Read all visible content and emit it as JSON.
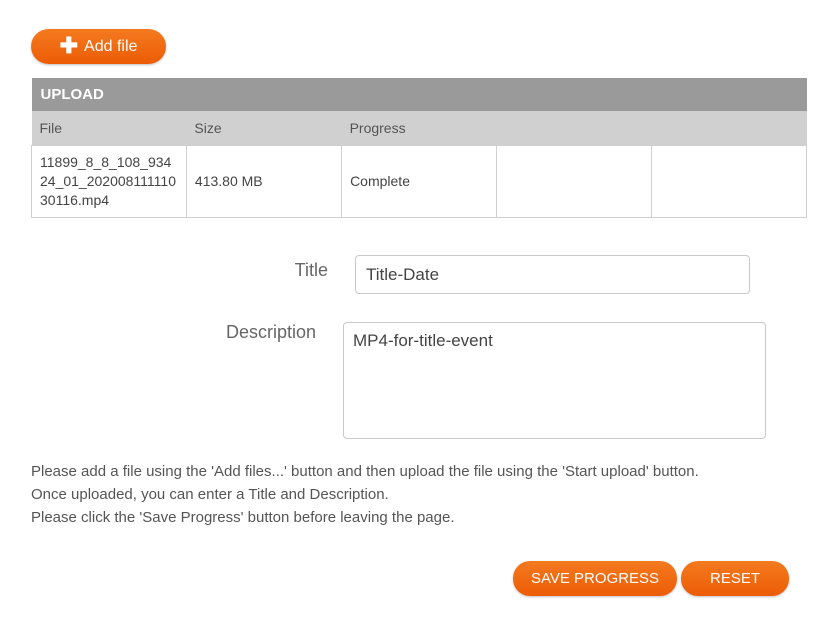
{
  "toolbar": {
    "add_file_label": "Add file",
    "add_icon": "plus-icon"
  },
  "upload": {
    "caption": "UPLOAD",
    "columns": [
      "File",
      "Size",
      "Progress",
      "",
      ""
    ],
    "rows": [
      {
        "file": "11899_8_8_108_93424_01_20200811111030116.mp4",
        "size": "413.80 MB",
        "progress": "Complete",
        "col4": "",
        "col5": ""
      }
    ]
  },
  "form": {
    "title_label": "Title",
    "title_value": "Title-Date",
    "description_label": "Description",
    "description_value": "MP4-for-title-event"
  },
  "instructions": [
    "Please add a file using the 'Add files...' button and then upload the file using the 'Start upload' button.",
    "Once uploaded, you can enter a Title and Description.",
    "Please click the 'Save Progress' button before leaving the page."
  ],
  "actions": {
    "save_label": "SAVE PROGRESS",
    "reset_label": "RESET"
  },
  "colors": {
    "accent": "#ec5c05",
    "table_caption_bg": "#9a9a9a",
    "table_header_bg": "#d0d0d0"
  }
}
